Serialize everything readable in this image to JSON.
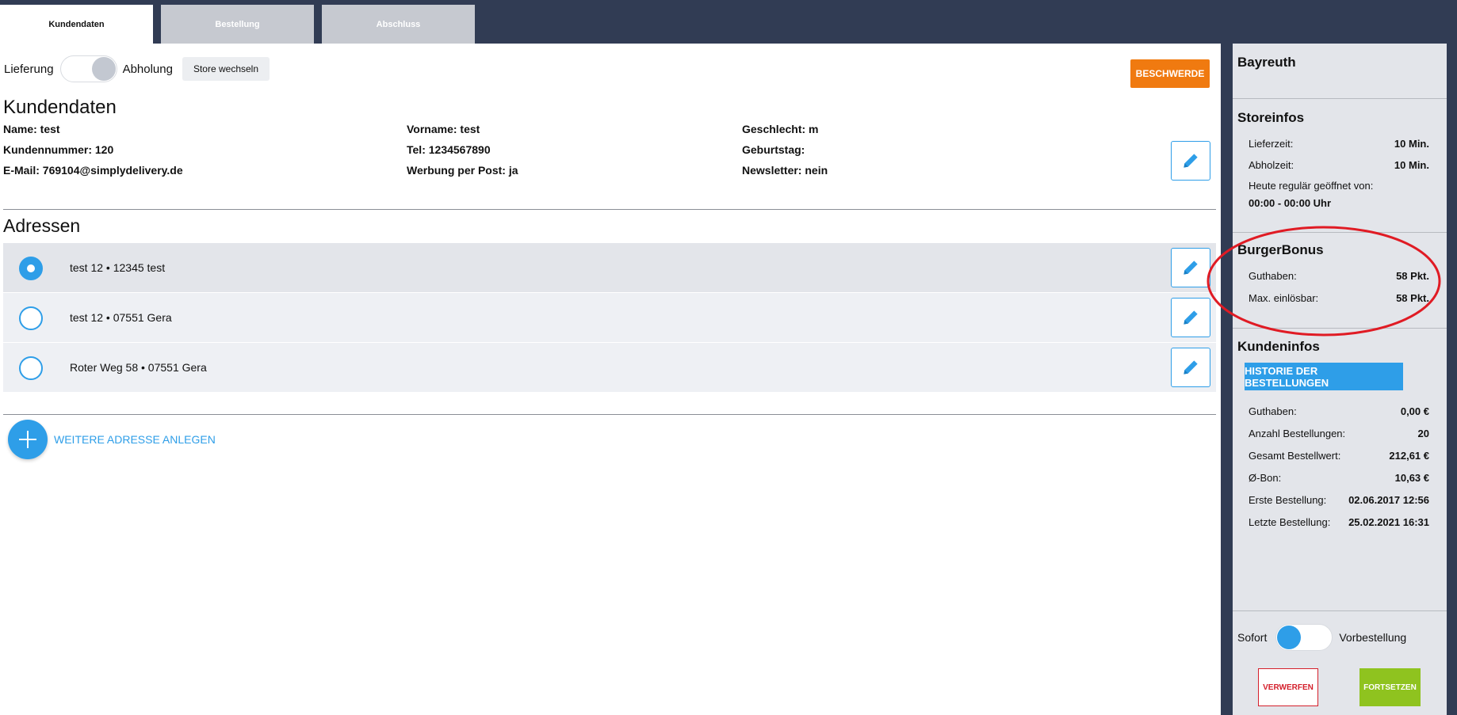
{
  "tabs": [
    "Kundendaten",
    "Bestellung",
    "Abschluss"
  ],
  "topbar": {
    "delivery_label": "Lieferung",
    "pickup_label": "Abholung",
    "store_switch": "Store wechseln",
    "complaint": "BESCHWERDE"
  },
  "customer": {
    "title": "Kundendaten",
    "name": "Name: test",
    "customer_number": "Kundennummer: 120",
    "email": "E-Mail: 769104@simplydelivery.de",
    "first_name": "Vorname: test",
    "phone": "Tel: 1234567890",
    "mail_ads": "Werbung per Post: ja",
    "gender": "Geschlecht: m",
    "birthday": "Geburtstag:",
    "newsletter": "Newsletter: nein"
  },
  "addresses": {
    "title": "Adressen",
    "items": [
      "test 12 • 12345 test",
      "test 12 • 07551 Gera",
      "Roter Weg 58 • 07551 Gera"
    ],
    "add_label": "WEITERE ADRESSE ANLEGEN"
  },
  "sidebar": {
    "store_name": "Bayreuth",
    "storeinfos": {
      "title": "Storeinfos",
      "delivery_time_label": "Lieferzeit:",
      "delivery_time_value": "10 Min.",
      "pickup_time_label": "Abholzeit:",
      "pickup_time_value": "10 Min.",
      "open_label": "Heute regulär geöffnet von:",
      "open_value": "00:00 - 00:00 Uhr"
    },
    "bonus": {
      "title": "BurgerBonus",
      "balance_label": "Guthaben:",
      "balance_value": "58 Pkt.",
      "max_label": "Max. einlösbar:",
      "max_value": "58 Pkt."
    },
    "customerinfos": {
      "title": "Kundeninfos",
      "history_button": "HISTORIE DER BESTELLUNGEN",
      "rows": [
        {
          "label": "Guthaben:",
          "value": "0,00 €"
        },
        {
          "label": "Anzahl Bestellungen:",
          "value": "20"
        },
        {
          "label": "Gesamt Bestellwert:",
          "value": "212,61 €"
        },
        {
          "label": "Ø-Bon:",
          "value": "10,63 €"
        },
        {
          "label": "Erste Bestellung:",
          "value": "02.06.2017 12:56"
        },
        {
          "label": "Letzte Bestellung:",
          "value": "25.02.2021 16:31"
        }
      ]
    },
    "order_mode": {
      "immediate_label": "Sofort",
      "preorder_label": "Vorbestellung"
    },
    "discard": "VERWERFEN",
    "continue": "FORTSETZEN"
  },
  "colors": {
    "accent": "#2e9ee8",
    "complaint": "#f07a10",
    "continue": "#8fc31f",
    "discard": "#d41f2b",
    "highlight": "#e01b24"
  }
}
